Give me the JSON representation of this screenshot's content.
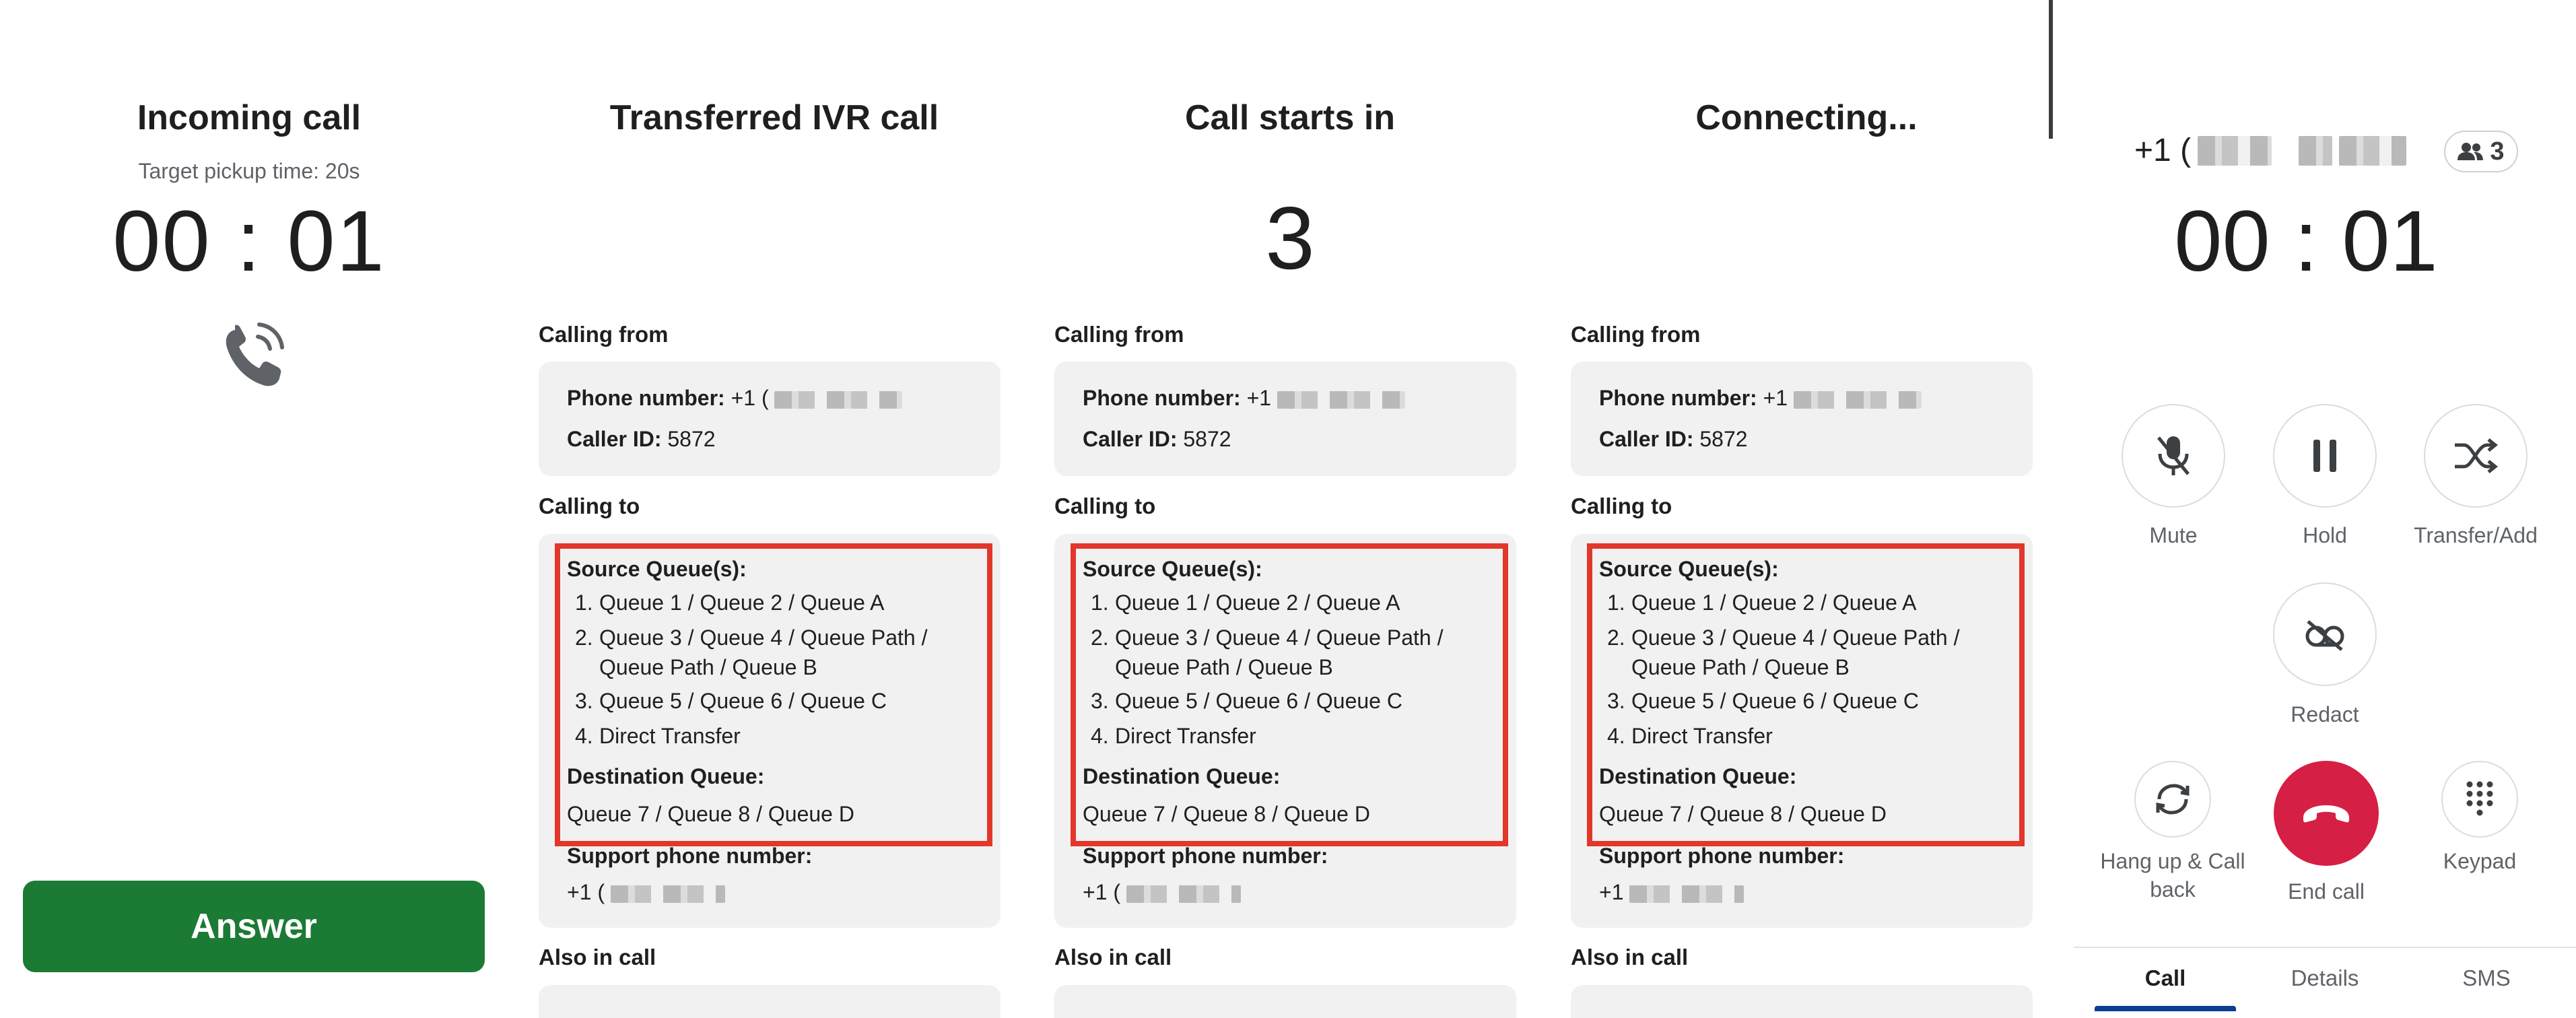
{
  "incoming": {
    "title": "Incoming call",
    "pickup_target": "Target pickup time: 20s",
    "timer": "00 : 01",
    "answer_label": "Answer"
  },
  "panels": [
    {
      "title": "Transferred IVR call",
      "big_number": "",
      "calling_from_label": "Calling from",
      "phone_label": "Phone number:",
      "phone_value": "+1 (",
      "caller_id_label": "Caller ID:",
      "caller_id_value": "5872",
      "calling_to_label": "Calling to",
      "source_label": "Source Queue(s):",
      "source_items": [
        {
          "num": "1.",
          "text": "Queue 1 / Queue 2 / Queue A",
          "cont": ""
        },
        {
          "num": "2.",
          "text": "Queue 3 / Queue 4 / Queue Path /",
          "cont": "Queue Path / Queue B"
        },
        {
          "num": "3.",
          "text": "Queue 5 / Queue 6 / Queue C",
          "cont": ""
        },
        {
          "num": "4.",
          "text": "Direct Transfer",
          "cont": ""
        }
      ],
      "destination_label": "Destination Queue:",
      "destination_value": "Queue 7 / Queue 8 / Queue D",
      "support_label": "Support phone number:",
      "support_value": "+1 (",
      "also_label": "Also in call"
    },
    {
      "title": "Call starts in",
      "big_number": "3",
      "calling_from_label": "Calling from",
      "phone_label": "Phone number:",
      "phone_value": "+1",
      "caller_id_label": "Caller ID:",
      "caller_id_value": "5872",
      "calling_to_label": "Calling to",
      "source_label": "Source Queue(s):",
      "source_items": [
        {
          "num": "1.",
          "text": "Queue 1 / Queue 2 / Queue A",
          "cont": ""
        },
        {
          "num": "2.",
          "text": "Queue 3 / Queue 4 / Queue Path /",
          "cont": "Queue Path / Queue B"
        },
        {
          "num": "3.",
          "text": "Queue 5 / Queue 6 / Queue C",
          "cont": ""
        },
        {
          "num": "4.",
          "text": "Direct Transfer",
          "cont": ""
        }
      ],
      "destination_label": "Destination Queue:",
      "destination_value": "Queue 7 / Queue 8 / Queue D",
      "support_label": "Support phone number:",
      "support_value": "+1 (",
      "also_label": "Also in call"
    },
    {
      "title": "Connecting...",
      "big_number": "",
      "calling_from_label": "Calling from",
      "phone_label": "Phone number:",
      "phone_value": "+1",
      "caller_id_label": "Caller ID:",
      "caller_id_value": "5872",
      "calling_to_label": "Calling to",
      "source_label": "Source Queue(s):",
      "source_items": [
        {
          "num": "1.",
          "text": "Queue 1 / Queue 2 / Queue A",
          "cont": ""
        },
        {
          "num": "2.",
          "text": "Queue 3 / Queue 4 / Queue Path /",
          "cont": "Queue Path / Queue B"
        },
        {
          "num": "3.",
          "text": "Queue 5 / Queue 6 / Queue C",
          "cont": ""
        },
        {
          "num": "4.",
          "text": "Direct Transfer",
          "cont": ""
        }
      ],
      "destination_label": "Destination Queue:",
      "destination_value": "Queue 7 / Queue 8 / Queue D",
      "support_label": "Support phone number:",
      "support_value": "+1",
      "also_label": "Also in call"
    }
  ],
  "active_call": {
    "number_prefix": "+1 (",
    "participants_count": "3",
    "timer": "00 : 01",
    "controls": {
      "mute": "Mute",
      "hold": "Hold",
      "transfer": "Transfer/Add",
      "redact": "Redact",
      "hangup_callback": "Hang up & Call back",
      "end_call": "End call",
      "keypad": "Keypad"
    },
    "tabs": [
      "Call",
      "Details",
      "SMS"
    ]
  },
  "colors": {
    "answer_green": "#1b7a34",
    "end_call_red": "#d61f44",
    "highlight_red": "#e2372a",
    "tab_underline": "#0b3d91"
  },
  "icons": [
    "phone-ringing-icon",
    "mic-off-icon",
    "pause-icon",
    "shuffle-icon",
    "redact-icon",
    "refresh-icon",
    "hangup-icon",
    "keypad-icon",
    "people-icon"
  ]
}
